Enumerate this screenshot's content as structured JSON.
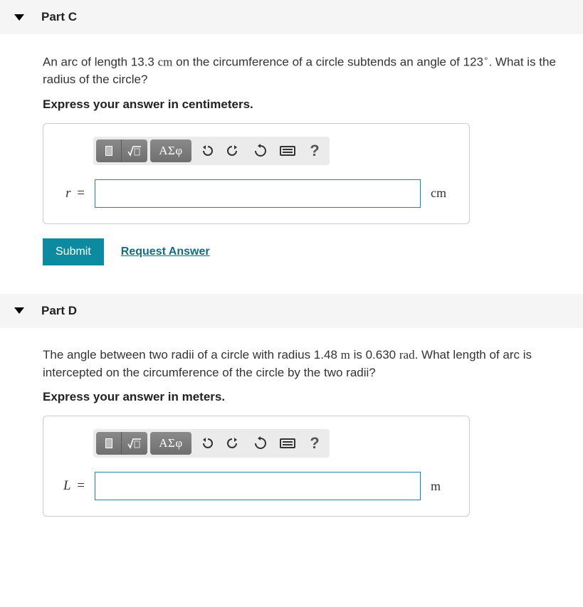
{
  "parts": {
    "c": {
      "title": "Part C",
      "question_html": "An arc of length 13.3 <span class='unit-inline'>cm</span> on the circumference of a circle subtends an angle of 123<sup>∘</sup>. What is the radius of the circle?",
      "instruction": "Express your answer in centimeters.",
      "var_symbol": "r",
      "unit": "cm",
      "greek_label": "ΑΣφ",
      "submit_label": "Submit",
      "request_label": "Request Answer"
    },
    "d": {
      "title": "Part D",
      "question_html": "The angle between two radii of a circle with radius 1.48 <span class='unit-inline'>m</span> is 0.630 <span class='unit-inline'>rad</span>. What length of arc is intercepted on the circumference of the circle by the two radii?",
      "instruction": "Express your answer in meters.",
      "var_symbol": "L",
      "unit": "m",
      "greek_label": "ΑΣφ"
    }
  }
}
